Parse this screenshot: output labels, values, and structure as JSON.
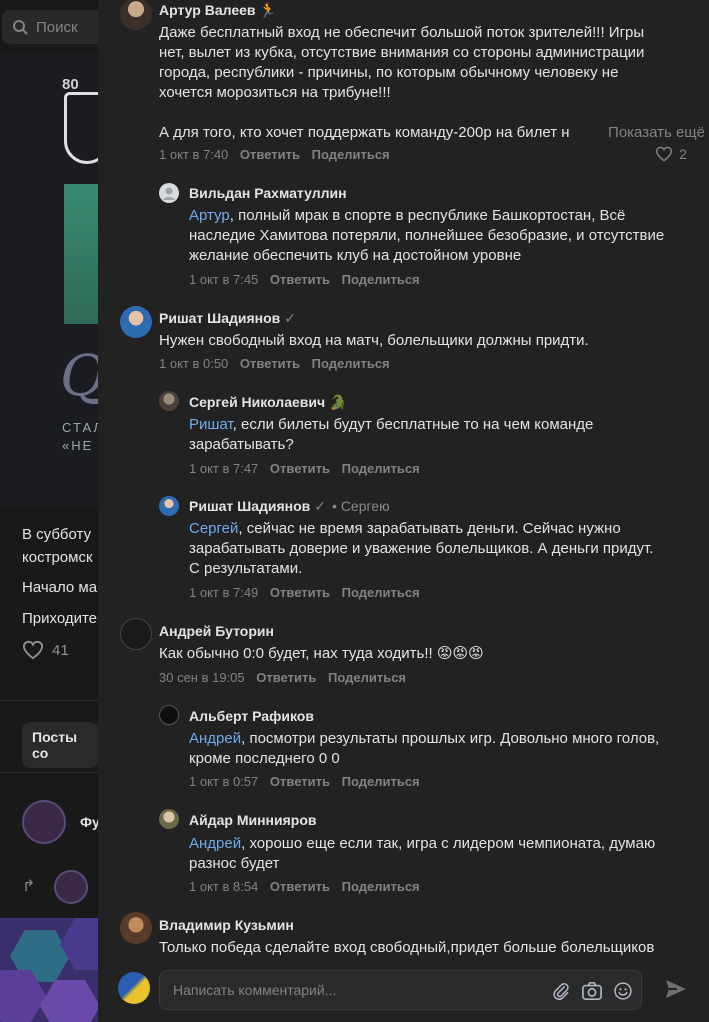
{
  "background": {
    "search_placeholder": "Поиск",
    "hero": {
      "logo_text": "80",
      "line1": "СТАЛ",
      "line2": "«НЕ"
    },
    "post_lines": [
      "В субботу",
      "костромск",
      "Начало ма",
      "Приходите"
    ],
    "likes_count": "41",
    "tab_label": "Посты со",
    "club_name_partial": "Фу"
  },
  "comments": [
    {
      "author": "Артур Валеев 🏃",
      "text_lines": [
        "Даже бесплатный вход не обеспечит большой поток зрителей!!! Игры",
        "нет, вылет из кубка, отсутствие внимания со стороны администрации",
        "города, республики - причины, по которым обычному человеку не",
        "хочется морозиться на трибуне!!!",
        "",
        "А для того, кто хочет поддержать команду-200р на билет н"
      ],
      "show_more": "Показать ещё",
      "date": "1 окт в 7:40",
      "reply": "Ответить",
      "share": "Поделиться",
      "likes": "2"
    },
    {
      "author": "Вильдан Рахматуллин",
      "mention": "Артур",
      "text_lines": [
        ", полный мрак в спорте в республике Башкортостан, Всё",
        "наследие Хамитова потеряли, полнейшее безобразие, и отсутствие",
        "желание обеспечить клуб на достойном уровне"
      ],
      "date": "1 окт в 7:45",
      "reply": "Ответить",
      "share": "Поделиться"
    },
    {
      "author": "Ришат Шадиянов",
      "verified": "✓",
      "text_lines": [
        "Нужен свободный вход на матч, болельщики должны придти."
      ],
      "date": "1 окт в 0:50",
      "reply": "Ответить",
      "share": "Поделиться"
    },
    {
      "author": "Сергей Николаевич 🐊",
      "mention": "Ришат",
      "text_lines": [
        ", если билеты будут бесплатные то на чем команде",
        "зарабатывать?"
      ],
      "date": "1 окт в 7:47",
      "reply": "Ответить",
      "share": "Поделиться"
    },
    {
      "author": "Ришат Шадиянов",
      "verified": "✓",
      "reply_to": "Сергею",
      "mention": "Сергей",
      "text_lines": [
        ", сейчас не время зарабатывать деньги. Сейчас нужно",
        "зарабатывать доверие и уважение болельщиков. А деньги придут.",
        "С результатами."
      ],
      "date": "1 окт в 7:49",
      "reply": "Ответить",
      "share": "Поделиться"
    },
    {
      "author": "Андрей Буторин",
      "text_lines": [
        "Как обычно 0:0 будет, нах туда ходить!! 😡😡😡"
      ],
      "date": "30 сен в 19:05",
      "reply": "Ответить",
      "share": "Поделиться"
    },
    {
      "author": "Альберт Рафиков",
      "mention": "Андрей",
      "text_lines": [
        ", посмотри результаты прошлых игр. Довольно много голов,",
        "кроме последнего 0 0"
      ],
      "date": "1 окт в 0:57",
      "reply": "Ответить",
      "share": "Поделиться"
    },
    {
      "author": "Айдар Миннияров",
      "mention": "Андрей",
      "text_lines": [
        ", хорошо еще если так, игра с лидером чемпионата, думаю",
        "разнос будет"
      ],
      "date": "1 окт в 8:54",
      "reply": "Ответить",
      "share": "Поделиться"
    },
    {
      "author": "Владимир Кузьмин",
      "text_lines": [
        "Только победа сделайте вход свободный,придет больше болельщиков"
      ]
    }
  ],
  "composer": {
    "placeholder": "Написать комментарий..."
  },
  "colors": {
    "panel_bg": "#222222",
    "mention": "#71aaeb",
    "meta": "#828282"
  },
  "icons": [
    "search-icon",
    "heart-icon",
    "paperclip-icon",
    "camera-icon",
    "emoji-icon",
    "send-icon",
    "repost-icon"
  ]
}
